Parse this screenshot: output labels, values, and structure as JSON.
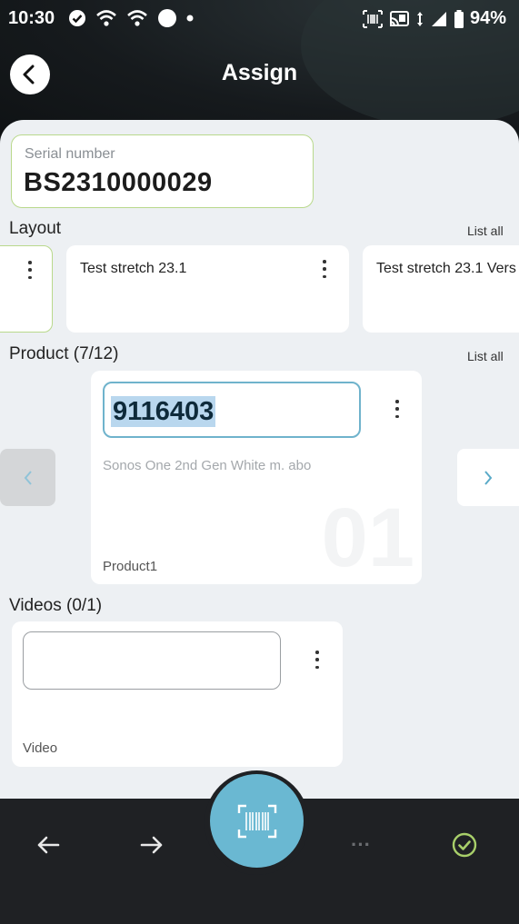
{
  "status": {
    "time": "10:30",
    "battery": "94%"
  },
  "header": {
    "title": "Assign"
  },
  "serial": {
    "label": "Serial number",
    "value": "BS2310000029"
  },
  "layout": {
    "title": "Layout",
    "list_all": "List all",
    "items": [
      {
        "name": ""
      },
      {
        "name": "Test stretch 23.1"
      },
      {
        "name": "Test stretch 23.1 Vers"
      }
    ]
  },
  "product": {
    "title": "Product (7/12)",
    "list_all": "List all",
    "input_value": "9116403",
    "description": "Sonos One 2nd Gen White m. abo",
    "watermark": "01",
    "label": "Product1"
  },
  "videos": {
    "title": "Videos (0/1)",
    "input_value": "",
    "label": "Video"
  },
  "bottom_bar": {
    "more": "···"
  },
  "colors": {
    "accent_green": "#b9d98c",
    "accent_blue": "#6ab8d2",
    "sheet_bg": "#edf0f3"
  }
}
